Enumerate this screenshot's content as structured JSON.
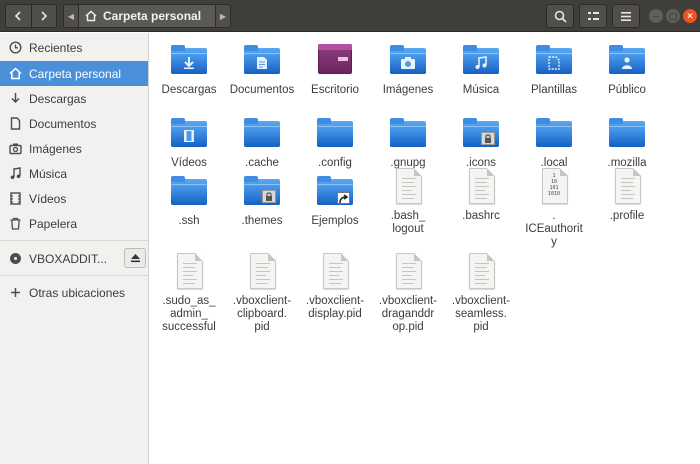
{
  "header": {
    "location": "Carpeta personal",
    "icons": {
      "back": "back-icon",
      "forward": "forward-icon",
      "search": "search-icon",
      "view": "list-view-icon",
      "menu": "hamburger-menu-icon"
    }
  },
  "sidebar": {
    "places": [
      {
        "label": "Recientes",
        "icon": "clock-icon"
      },
      {
        "label": "Carpeta personal",
        "icon": "home-icon",
        "active": true
      },
      {
        "label": "Descargas",
        "icon": "download-icon"
      },
      {
        "label": "Documentos",
        "icon": "document-icon"
      },
      {
        "label": "Imágenes",
        "icon": "camera-icon"
      },
      {
        "label": "Música",
        "icon": "music-icon"
      },
      {
        "label": "Vídeos",
        "icon": "film-icon"
      },
      {
        "label": "Papelera",
        "icon": "trash-icon"
      }
    ],
    "device": {
      "label": "VBOXADDIT...",
      "icon": "disc-icon",
      "eject_icon": "eject-icon"
    },
    "other": {
      "label": "Otras ubicaciones",
      "icon": "plus-icon"
    }
  },
  "files": [
    {
      "name": "Descargas",
      "type": "folder",
      "emblem": "download"
    },
    {
      "name": "Documentos",
      "type": "folder",
      "emblem": "document"
    },
    {
      "name": "Escritorio",
      "type": "desktop"
    },
    {
      "name": "Imágenes",
      "type": "folder",
      "emblem": "image"
    },
    {
      "name": "Música",
      "type": "folder",
      "emblem": "music"
    },
    {
      "name": "Plantillas",
      "type": "folder",
      "emblem": "template"
    },
    {
      "name": "Público",
      "type": "folder",
      "emblem": "person"
    },
    {
      "name": "Vídeos",
      "type": "folder",
      "emblem": "film"
    },
    {
      "name": ".cache",
      "type": "folder"
    },
    {
      "name": ".config",
      "type": "folder"
    },
    {
      "name": ".gnupg",
      "type": "folder"
    },
    {
      "name": ".icons",
      "type": "folder",
      "emblem": "lock"
    },
    {
      "name": ".local",
      "type": "folder"
    },
    {
      "name": ".mozilla",
      "type": "folder"
    },
    {
      "name": ".ssh",
      "type": "folder"
    },
    {
      "name": ".themes",
      "type": "folder",
      "emblem": "lock"
    },
    {
      "name": "Ejemplos",
      "type": "folder",
      "emblem": "link"
    },
    {
      "name": ".bash_\nlogout",
      "type": "text"
    },
    {
      "name": ".bashrc",
      "type": "text"
    },
    {
      "name": ".\nICEauthorit\ny",
      "type": "binary"
    },
    {
      "name": ".profile",
      "type": "text"
    },
    {
      "name": ".sudo_as_\nadmin_\nsuccessful",
      "type": "text"
    },
    {
      "name": ".vboxclient-\nclipboard.\npid",
      "type": "text"
    },
    {
      "name": ".vboxclient-\ndisplay.pid",
      "type": "text"
    },
    {
      "name": ".vboxclient-\ndraganddr\nop.pid",
      "type": "text"
    },
    {
      "name": ".vboxclient-\nseamless.\npid",
      "type": "text"
    }
  ],
  "colors": {
    "headerbar": "#3f3e3a",
    "selection": "#4a90d9",
    "folder": "#2b7fe0",
    "close": "#e95420"
  }
}
